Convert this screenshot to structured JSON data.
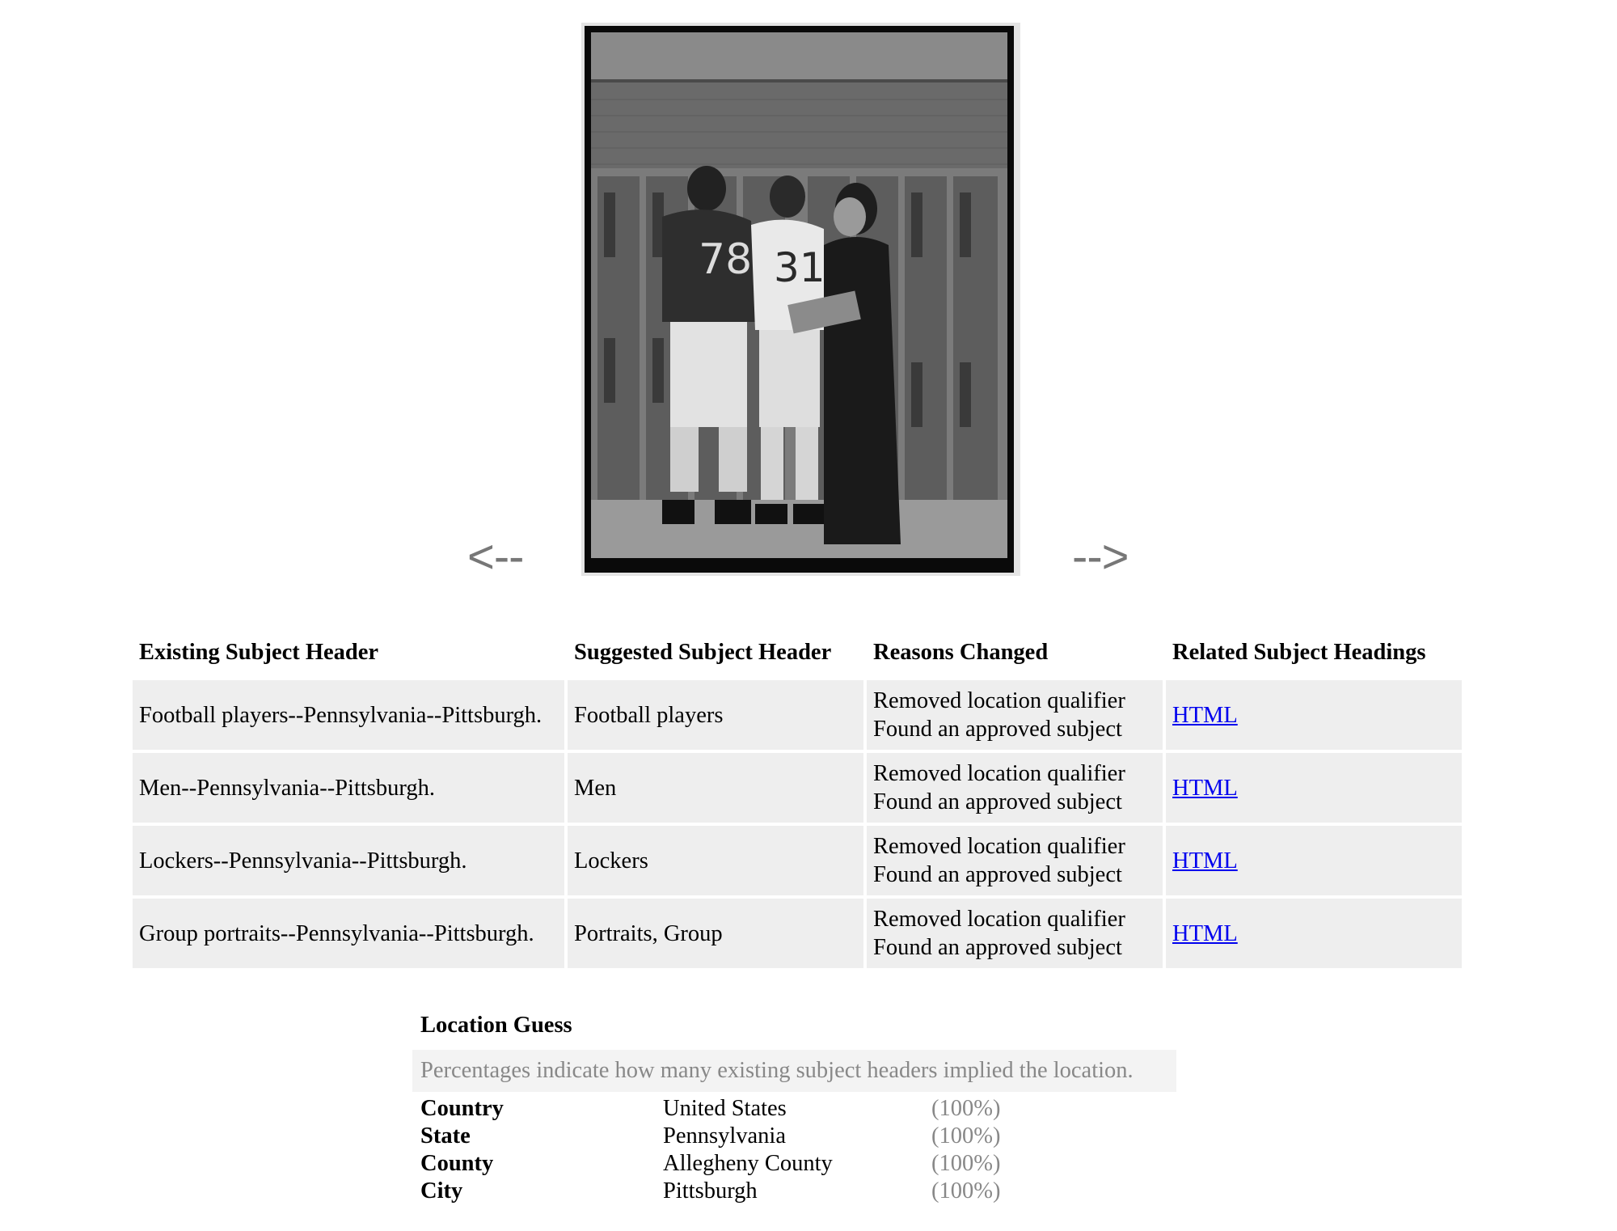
{
  "viewer": {
    "prev_label": "<--",
    "next_label": "-->",
    "photo": {
      "description_icon": "photograph-football-players-locker-room",
      "jersey_numbers": [
        "78",
        "31"
      ]
    }
  },
  "subject_table": {
    "headers": {
      "existing": "Existing Subject Header",
      "suggested": "Suggested Subject Header",
      "reasons": "Reasons Changed",
      "related": "Related Subject Headings"
    },
    "rows": [
      {
        "existing": "Football players--Pennsylvania--Pittsburgh.",
        "suggested": "Football players",
        "reason_1": "Removed location qualifier",
        "reason_2": "Found an approved subject",
        "related": "HTML"
      },
      {
        "existing": "Men--Pennsylvania--Pittsburgh.",
        "suggested": "Men",
        "reason_1": "Removed location qualifier",
        "reason_2": "Found an approved subject",
        "related": "HTML"
      },
      {
        "existing": "Lockers--Pennsylvania--Pittsburgh.",
        "suggested": "Lockers",
        "reason_1": "Removed location qualifier",
        "reason_2": "Found an approved subject",
        "related": "HTML"
      },
      {
        "existing": "Group portraits--Pennsylvania--Pittsburgh.",
        "suggested": "Portraits, Group",
        "reason_1": "Removed location qualifier",
        "reason_2": "Found an approved subject",
        "related": "HTML"
      }
    ]
  },
  "location_guess": {
    "title": "Location Guess",
    "note": "Percentages indicate how many existing subject headers implied the location.",
    "rows": [
      {
        "label": "Country",
        "value": "United States",
        "pct": "(100%)"
      },
      {
        "label": "State",
        "value": "Pennsylvania",
        "pct": "(100%)"
      },
      {
        "label": "County",
        "value": "Allegheny County",
        "pct": "(100%)"
      },
      {
        "label": "City",
        "value": "Pittsburgh",
        "pct": "(100%)"
      }
    ]
  },
  "colors": {
    "link": "#0000ee",
    "row_bg": "#eeeeee",
    "muted_text": "#888888",
    "arrow": "#777777"
  }
}
